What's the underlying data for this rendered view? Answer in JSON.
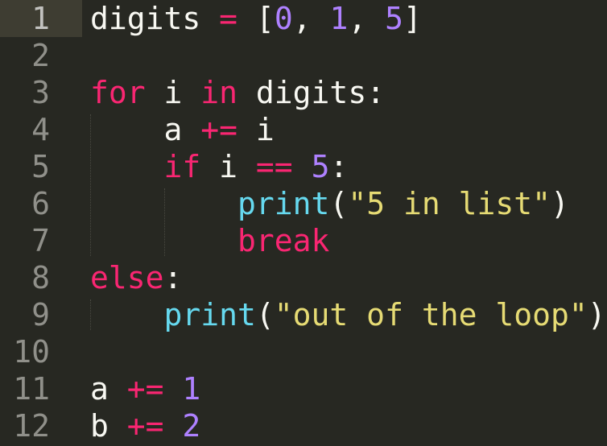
{
  "editor": {
    "lines": [
      {
        "number": "1",
        "tokens": [
          {
            "text": "digits",
            "type": "pl"
          },
          {
            "text": " ",
            "type": "pl"
          },
          {
            "text": "=",
            "type": "op"
          },
          {
            "text": " [",
            "type": "pl"
          },
          {
            "text": "0",
            "type": "num"
          },
          {
            "text": ", ",
            "type": "pl"
          },
          {
            "text": "1",
            "type": "num"
          },
          {
            "text": ", ",
            "type": "pl"
          },
          {
            "text": "5",
            "type": "num"
          },
          {
            "text": "]",
            "type": "pl"
          }
        ]
      },
      {
        "number": "2",
        "tokens": []
      },
      {
        "number": "3",
        "tokens": [
          {
            "text": "for",
            "type": "kw"
          },
          {
            "text": " i ",
            "type": "pl"
          },
          {
            "text": "in",
            "type": "kw"
          },
          {
            "text": " digits:",
            "type": "pl"
          }
        ]
      },
      {
        "number": "4",
        "tokens": [
          {
            "text": "    a ",
            "type": "pl"
          },
          {
            "text": "+=",
            "type": "op"
          },
          {
            "text": " i",
            "type": "pl"
          }
        ]
      },
      {
        "number": "5",
        "tokens": [
          {
            "text": "    ",
            "type": "pl"
          },
          {
            "text": "if",
            "type": "kw"
          },
          {
            "text": " i ",
            "type": "pl"
          },
          {
            "text": "==",
            "type": "op"
          },
          {
            "text": " ",
            "type": "pl"
          },
          {
            "text": "5",
            "type": "num"
          },
          {
            "text": ":",
            "type": "pl"
          }
        ]
      },
      {
        "number": "6",
        "tokens": [
          {
            "text": "        ",
            "type": "pl"
          },
          {
            "text": "print",
            "type": "fn"
          },
          {
            "text": "(",
            "type": "pl"
          },
          {
            "text": "\"5 in list\"",
            "type": "str"
          },
          {
            "text": ")",
            "type": "pl"
          }
        ]
      },
      {
        "number": "7",
        "tokens": [
          {
            "text": "        ",
            "type": "pl"
          },
          {
            "text": "break",
            "type": "kw"
          }
        ]
      },
      {
        "number": "8",
        "tokens": [
          {
            "text": "else",
            "type": "kw"
          },
          {
            "text": ":",
            "type": "pl"
          }
        ]
      },
      {
        "number": "9",
        "tokens": [
          {
            "text": "    ",
            "type": "pl"
          },
          {
            "text": "print",
            "type": "fn"
          },
          {
            "text": "(",
            "type": "pl"
          },
          {
            "text": "\"out of the loop\"",
            "type": "str"
          },
          {
            "text": ")",
            "type": "pl"
          }
        ]
      },
      {
        "number": "10",
        "tokens": []
      },
      {
        "number": "11",
        "tokens": [
          {
            "text": "a ",
            "type": "pl"
          },
          {
            "text": "+=",
            "type": "op"
          },
          {
            "text": " ",
            "type": "pl"
          },
          {
            "text": "1",
            "type": "num"
          }
        ]
      },
      {
        "number": "12",
        "tokens": [
          {
            "text": "b ",
            "type": "pl"
          },
          {
            "text": "+=",
            "type": "op"
          },
          {
            "text": " ",
            "type": "pl"
          },
          {
            "text": "2",
            "type": "num"
          }
        ]
      }
    ],
    "current_line": "1",
    "colors": {
      "background": "#272822",
      "keyword": "#f92672",
      "number": "#ae81ff",
      "string": "#e6db74",
      "function": "#66d9ef",
      "plain": "#f8f8f2",
      "gutter_text": "#90908a"
    }
  }
}
